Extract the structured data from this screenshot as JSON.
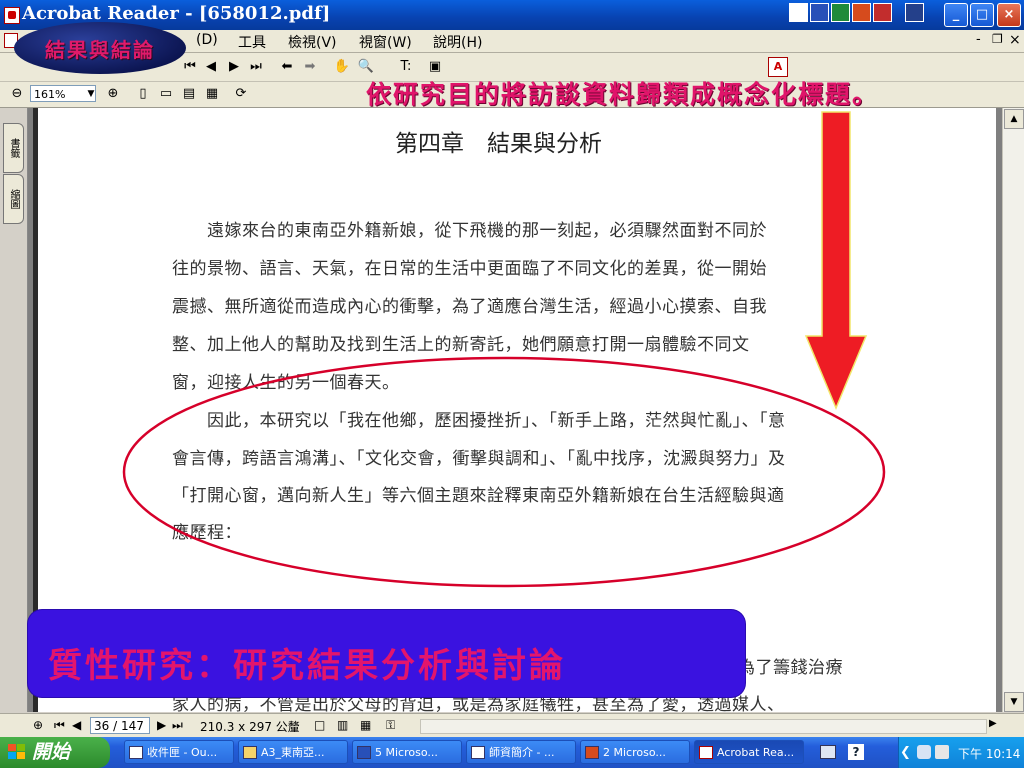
{
  "window": {
    "title": "Acrobat Reader - [658012.pdf]",
    "minimize": "_",
    "maximize": "□",
    "close": "×"
  },
  "menu": {
    "items": [
      "(D)",
      "工具",
      "檢視(V)",
      "視窗(W)",
      "說明(H)"
    ],
    "min": "-",
    "restore": "฿",
    "close": "×"
  },
  "toolbar": {
    "zoom_value": "161%",
    "text_tool": "T:",
    "zoom_minus": "⊖",
    "zoom_plus": "⊕"
  },
  "navtabs": [
    "書籤",
    "縮圖"
  ],
  "document": {
    "heading": "第四章　結果與分析",
    "lines": [
      "　　遠嫁來台的東南亞外籍新娘，從下飛機的那一刻起，必須驟然面對不同於",
      "往的景物、語言、天氣，在日常的生活中更面臨了不同文化的差異，從一開始",
      "震撼、無所適從而造成內心的衝擊，為了適應台灣生活，經過小心摸索、自我",
      "整、加上他人的幫助及找到生活上的新寄託，她們願意打開一扇體驗不同文",
      "窗，迎接人生的另一個春天。",
      "　　因此，本研究以「我在他鄉，歷困擾挫折」、「新手上路，茫然與忙亂」、「意",
      "會言傳，跨語言鴻溝」、「文化交會，衝擊與調和」、「亂中找序，沈澱與努力」及",
      "「打開心窗，邁向新人生」等六個主題來詮釋東南亞外籍新娘在台生活經驗與適",
      "應歷程：",
      "為了籌錢治療",
      "家人的病，不管是出於父母的背迫，或是為家庭犧牲，甚至為了愛，透過媒人、"
    ]
  },
  "statusbar": {
    "page": "36 / 147",
    "size": "210.3 x 297 公釐"
  },
  "taskbar": {
    "start": "開始",
    "tasks": [
      "收件匣 - Ou...",
      "A3_東南亞...",
      "5 Microso...",
      "師資簡介 - ...",
      "2 Microso...",
      "Acrobat Rea..."
    ],
    "clock": "下午 10:14"
  },
  "overlay": {
    "badge": "結果與結論",
    "caption_top": "依研究目的將訪談資料歸類成概念化標題。",
    "caption_bottom": "質性研究：研究結果分析與討論"
  },
  "colors": {
    "caption": "#e0146a",
    "arrow": "#ee1c24",
    "panel": "#3a12e0",
    "ellipse": "#d6002a"
  }
}
